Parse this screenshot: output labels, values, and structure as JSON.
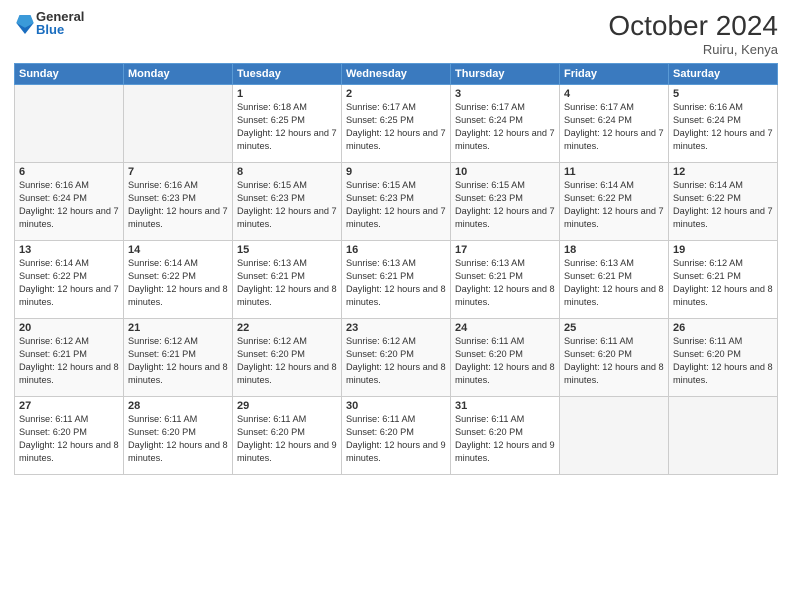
{
  "logo": {
    "general": "General",
    "blue": "Blue"
  },
  "title": "October 2024",
  "subtitle": "Ruiru, Kenya",
  "days_header": [
    "Sunday",
    "Monday",
    "Tuesday",
    "Wednesday",
    "Thursday",
    "Friday",
    "Saturday"
  ],
  "weeks": [
    [
      {
        "num": "",
        "info": ""
      },
      {
        "num": "",
        "info": ""
      },
      {
        "num": "1",
        "info": "Sunrise: 6:18 AM\nSunset: 6:25 PM\nDaylight: 12 hours and 7 minutes."
      },
      {
        "num": "2",
        "info": "Sunrise: 6:17 AM\nSunset: 6:25 PM\nDaylight: 12 hours and 7 minutes."
      },
      {
        "num": "3",
        "info": "Sunrise: 6:17 AM\nSunset: 6:24 PM\nDaylight: 12 hours and 7 minutes."
      },
      {
        "num": "4",
        "info": "Sunrise: 6:17 AM\nSunset: 6:24 PM\nDaylight: 12 hours and 7 minutes."
      },
      {
        "num": "5",
        "info": "Sunrise: 6:16 AM\nSunset: 6:24 PM\nDaylight: 12 hours and 7 minutes."
      }
    ],
    [
      {
        "num": "6",
        "info": "Sunrise: 6:16 AM\nSunset: 6:24 PM\nDaylight: 12 hours and 7 minutes."
      },
      {
        "num": "7",
        "info": "Sunrise: 6:16 AM\nSunset: 6:23 PM\nDaylight: 12 hours and 7 minutes."
      },
      {
        "num": "8",
        "info": "Sunrise: 6:15 AM\nSunset: 6:23 PM\nDaylight: 12 hours and 7 minutes."
      },
      {
        "num": "9",
        "info": "Sunrise: 6:15 AM\nSunset: 6:23 PM\nDaylight: 12 hours and 7 minutes."
      },
      {
        "num": "10",
        "info": "Sunrise: 6:15 AM\nSunset: 6:23 PM\nDaylight: 12 hours and 7 minutes."
      },
      {
        "num": "11",
        "info": "Sunrise: 6:14 AM\nSunset: 6:22 PM\nDaylight: 12 hours and 7 minutes."
      },
      {
        "num": "12",
        "info": "Sunrise: 6:14 AM\nSunset: 6:22 PM\nDaylight: 12 hours and 7 minutes."
      }
    ],
    [
      {
        "num": "13",
        "info": "Sunrise: 6:14 AM\nSunset: 6:22 PM\nDaylight: 12 hours and 7 minutes."
      },
      {
        "num": "14",
        "info": "Sunrise: 6:14 AM\nSunset: 6:22 PM\nDaylight: 12 hours and 8 minutes."
      },
      {
        "num": "15",
        "info": "Sunrise: 6:13 AM\nSunset: 6:21 PM\nDaylight: 12 hours and 8 minutes."
      },
      {
        "num": "16",
        "info": "Sunrise: 6:13 AM\nSunset: 6:21 PM\nDaylight: 12 hours and 8 minutes."
      },
      {
        "num": "17",
        "info": "Sunrise: 6:13 AM\nSunset: 6:21 PM\nDaylight: 12 hours and 8 minutes."
      },
      {
        "num": "18",
        "info": "Sunrise: 6:13 AM\nSunset: 6:21 PM\nDaylight: 12 hours and 8 minutes."
      },
      {
        "num": "19",
        "info": "Sunrise: 6:12 AM\nSunset: 6:21 PM\nDaylight: 12 hours and 8 minutes."
      }
    ],
    [
      {
        "num": "20",
        "info": "Sunrise: 6:12 AM\nSunset: 6:21 PM\nDaylight: 12 hours and 8 minutes."
      },
      {
        "num": "21",
        "info": "Sunrise: 6:12 AM\nSunset: 6:21 PM\nDaylight: 12 hours and 8 minutes."
      },
      {
        "num": "22",
        "info": "Sunrise: 6:12 AM\nSunset: 6:20 PM\nDaylight: 12 hours and 8 minutes."
      },
      {
        "num": "23",
        "info": "Sunrise: 6:12 AM\nSunset: 6:20 PM\nDaylight: 12 hours and 8 minutes."
      },
      {
        "num": "24",
        "info": "Sunrise: 6:11 AM\nSunset: 6:20 PM\nDaylight: 12 hours and 8 minutes."
      },
      {
        "num": "25",
        "info": "Sunrise: 6:11 AM\nSunset: 6:20 PM\nDaylight: 12 hours and 8 minutes."
      },
      {
        "num": "26",
        "info": "Sunrise: 6:11 AM\nSunset: 6:20 PM\nDaylight: 12 hours and 8 minutes."
      }
    ],
    [
      {
        "num": "27",
        "info": "Sunrise: 6:11 AM\nSunset: 6:20 PM\nDaylight: 12 hours and 8 minutes."
      },
      {
        "num": "28",
        "info": "Sunrise: 6:11 AM\nSunset: 6:20 PM\nDaylight: 12 hours and 8 minutes."
      },
      {
        "num": "29",
        "info": "Sunrise: 6:11 AM\nSunset: 6:20 PM\nDaylight: 12 hours and 9 minutes."
      },
      {
        "num": "30",
        "info": "Sunrise: 6:11 AM\nSunset: 6:20 PM\nDaylight: 12 hours and 9 minutes."
      },
      {
        "num": "31",
        "info": "Sunrise: 6:11 AM\nSunset: 6:20 PM\nDaylight: 12 hours and 9 minutes."
      },
      {
        "num": "",
        "info": ""
      },
      {
        "num": "",
        "info": ""
      }
    ]
  ]
}
